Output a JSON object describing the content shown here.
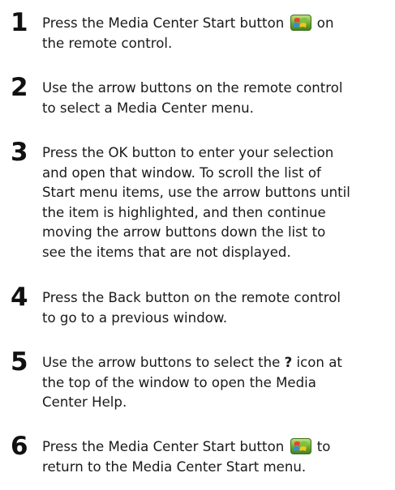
{
  "steps": [
    {
      "number": "1",
      "lines": [
        {
          "before": "Press the Media Center Start button ",
          "icon": "windows-start-icon",
          "after": " on"
        },
        {
          "text": "the remote control."
        }
      ]
    },
    {
      "number": "2",
      "lines": [
        {
          "text": "Use the arrow buttons on the remote control"
        },
        {
          "text": "to select a Media Center menu."
        }
      ]
    },
    {
      "number": "3",
      "lines": [
        {
          "text": "Press the OK button to enter your selection"
        },
        {
          "text": "and open that window. To scroll the list of"
        },
        {
          "text": "Start menu items, use the arrow buttons until"
        },
        {
          "text": "the item is highlighted, and then continue"
        },
        {
          "text": "moving the arrow buttons down the list to"
        },
        {
          "text": "see the items that are not displayed."
        }
      ]
    },
    {
      "number": "4",
      "lines": [
        {
          "text": "Press the Back button on the remote control"
        },
        {
          "text": "to go to a previous window."
        }
      ]
    },
    {
      "number": "5",
      "lines": [
        {
          "before": "Use the arrow buttons to select the ",
          "bold": "?",
          "after": " icon at"
        },
        {
          "text": "the top of the window to open the Media"
        },
        {
          "text": "Center Help."
        }
      ]
    },
    {
      "number": "6",
      "lines": [
        {
          "before": "Press the Media Center Start button ",
          "icon": "windows-start-icon",
          "after": " to"
        },
        {
          "text": "return to the Media Center Start menu."
        }
      ]
    }
  ]
}
